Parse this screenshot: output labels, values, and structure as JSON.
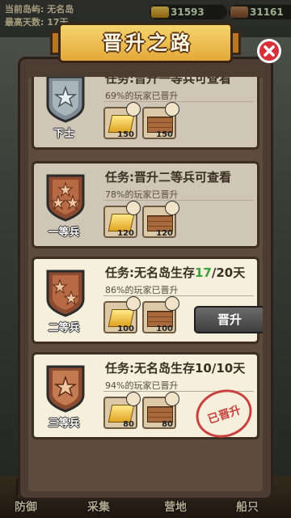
{
  "topbar": {
    "info_line1": "当前岛屿: 无名岛",
    "info_line2": "最高天数: 17天",
    "resource_gold": "31593",
    "resource_wood": "31161"
  },
  "modal": {
    "title": "晋升之路",
    "cards": [
      {
        "badge_label": "下士",
        "task": "任务:晋升一等兵可查看",
        "percent_text": "69%的玩家已晋升",
        "reward_gold": "150",
        "reward_wood": "150",
        "state": "locked"
      },
      {
        "badge_label": "一等兵",
        "task": "任务:晋升二等兵可查看",
        "percent_text": "78%的玩家已晋升",
        "reward_gold": "120",
        "reward_wood": "120",
        "state": "locked"
      },
      {
        "badge_label": "二等兵",
        "task_prefix": "任务:无名岛生存",
        "task_progress": "17",
        "task_suffix": "/20天",
        "percent_text": "86%的玩家已晋升",
        "reward_gold": "100",
        "reward_wood": "100",
        "button_label": "晋升",
        "state": "in-progress"
      },
      {
        "badge_label": "三等兵",
        "task": "任务:无名岛生存10/10天",
        "percent_text": "94%的玩家已晋升",
        "reward_gold": "80",
        "reward_wood": "80",
        "stamp_label": "已晋升",
        "state": "completed"
      }
    ]
  },
  "bottom_nav": [
    {
      "label": "防御"
    },
    {
      "label": "采集"
    },
    {
      "label": "营地"
    },
    {
      "label": "船只"
    }
  ],
  "colors": {
    "progress_highlight": "#3aa13a",
    "banner": "#f0c24e",
    "close": "#d8313a",
    "stamp": "#c9423f"
  }
}
